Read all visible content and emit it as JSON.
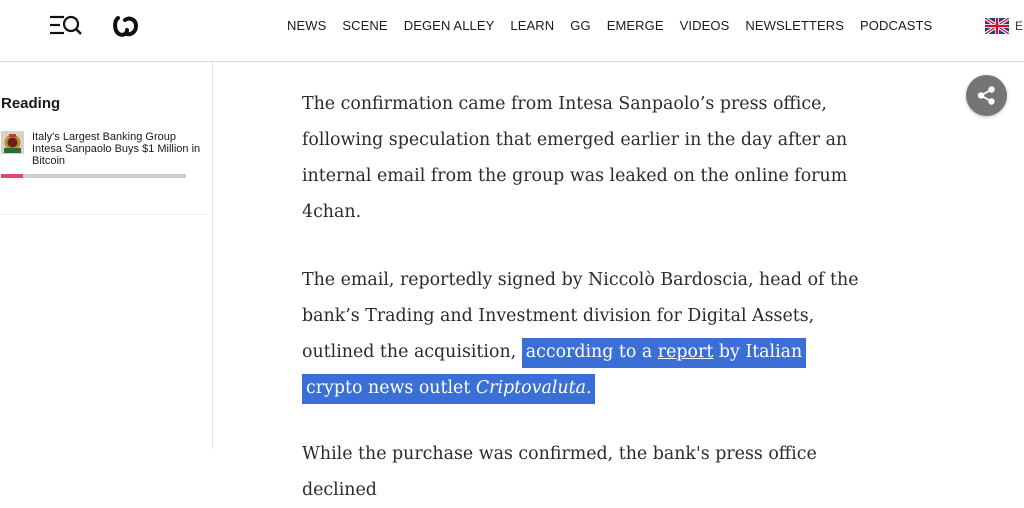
{
  "header": {
    "nav": [
      "NEWS",
      "SCENE",
      "DEGEN ALLEY",
      "LEARN",
      "GG",
      "EMERGE",
      "VIDEOS",
      "NEWSLETTERS",
      "PODCASTS"
    ],
    "language": "E",
    "icons": {
      "menu": "menu-search-icon",
      "logo": "decrypt-logo",
      "flag": "uk-flag-icon"
    }
  },
  "sidebar": {
    "title": "Reading",
    "article_title": "Italy's Largest Banking Group Intesa Sanpaolo Buys $1 Million in Bitcoin",
    "progress_fraction": 0.12
  },
  "article": {
    "p1": "The confirmation came from Intesa Sanpaolo’s press office, following speculation that emerged earlier in the day after an internal email from the group was leaked on the online forum 4chan.",
    "p2_before": "The email, reportedly signed by Niccolò Bardoscia, head of the bank’s Trading and Investment division for Digital Assets, outlined the acquisition,",
    "p2_hl_1": "according to a",
    "p2_link": "report",
    "p2_hl_2": "by Italian crypto news outlet",
    "p2_outlet": "Criptovaluta",
    "p2_end": ".",
    "p3": "While the purchase was confirmed, the bank's press office declined"
  },
  "colors": {
    "highlight": "#3a6fd6",
    "progress": "#e04a6a",
    "share": "#757575"
  }
}
